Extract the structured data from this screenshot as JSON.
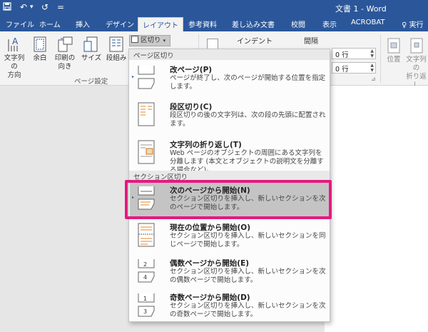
{
  "titlebar": {
    "title": "文書 1 - Word",
    "qat": [
      "save-icon",
      "undo-icon",
      "redo-icon"
    ],
    "redo_label": "↺",
    "more_label": "="
  },
  "tabs": [
    {
      "label": "ファイル"
    },
    {
      "label": "ホーム"
    },
    {
      "label": "挿入"
    },
    {
      "label": "デザイン"
    },
    {
      "label": "レイアウト",
      "active": true
    },
    {
      "label": "参考資料"
    },
    {
      "label": "差し込み文書"
    },
    {
      "label": "校閲"
    },
    {
      "label": "表示"
    },
    {
      "label": "ACROBAT"
    },
    {
      "label": "♀ 実行"
    }
  ],
  "ribbon": {
    "buttons": {
      "text_direction": "文字列の\n方向",
      "margins": "余白",
      "orientation": "印刷の\n向き",
      "size": "サイズ",
      "columns": "段組み",
      "breaks": "区切り"
    },
    "page_setup_label": "ページ設定",
    "indent_label": "インデント",
    "spacing_label": "間隔",
    "spacing_before": "0 行",
    "spacing_after": "0 行",
    "position_label": "位置",
    "wrap_label": "文字列の\n折り返し"
  },
  "dropdown": {
    "page_breaks_header": "ページ区切り",
    "section_breaks_header": "セクション区切り",
    "items": [
      {
        "title": "改ページ(P)",
        "desc": "ページが終了し、次のページが開始する位置を指定します。"
      },
      {
        "title": "段区切り(C)",
        "desc": "段区切りの後の文字列は、次の段の先頭に配置されます。"
      },
      {
        "title": "文字列の折り返し(T)",
        "desc": "Web ページのオブジェクトの周囲にある文字列を分離します (本文とオブジェクトの説明文を分離する場合など)。"
      },
      {
        "title": "次のページから開始(N)",
        "desc": "セクション区切りを挿入し、新しいセクションを次のページで開始します。"
      },
      {
        "title": "現在の位置から開始(O)",
        "desc": "セクション区切りを挿入し、新しいセクションを同じページで開始します。"
      },
      {
        "title": "偶数ページから開始(E)",
        "desc": "セクション区切りを挿入し、新しいセクションを次の偶数ページで開始します。"
      },
      {
        "title": "奇数ページから開始(D)",
        "desc": "セクション区切りを挿入し、新しいセクションを次の奇数ページで開始します。"
      }
    ]
  },
  "colors": {
    "word_blue": "#2b579a",
    "highlight_pink": "#e6197f",
    "hover_gray": "#c4c4c4"
  }
}
